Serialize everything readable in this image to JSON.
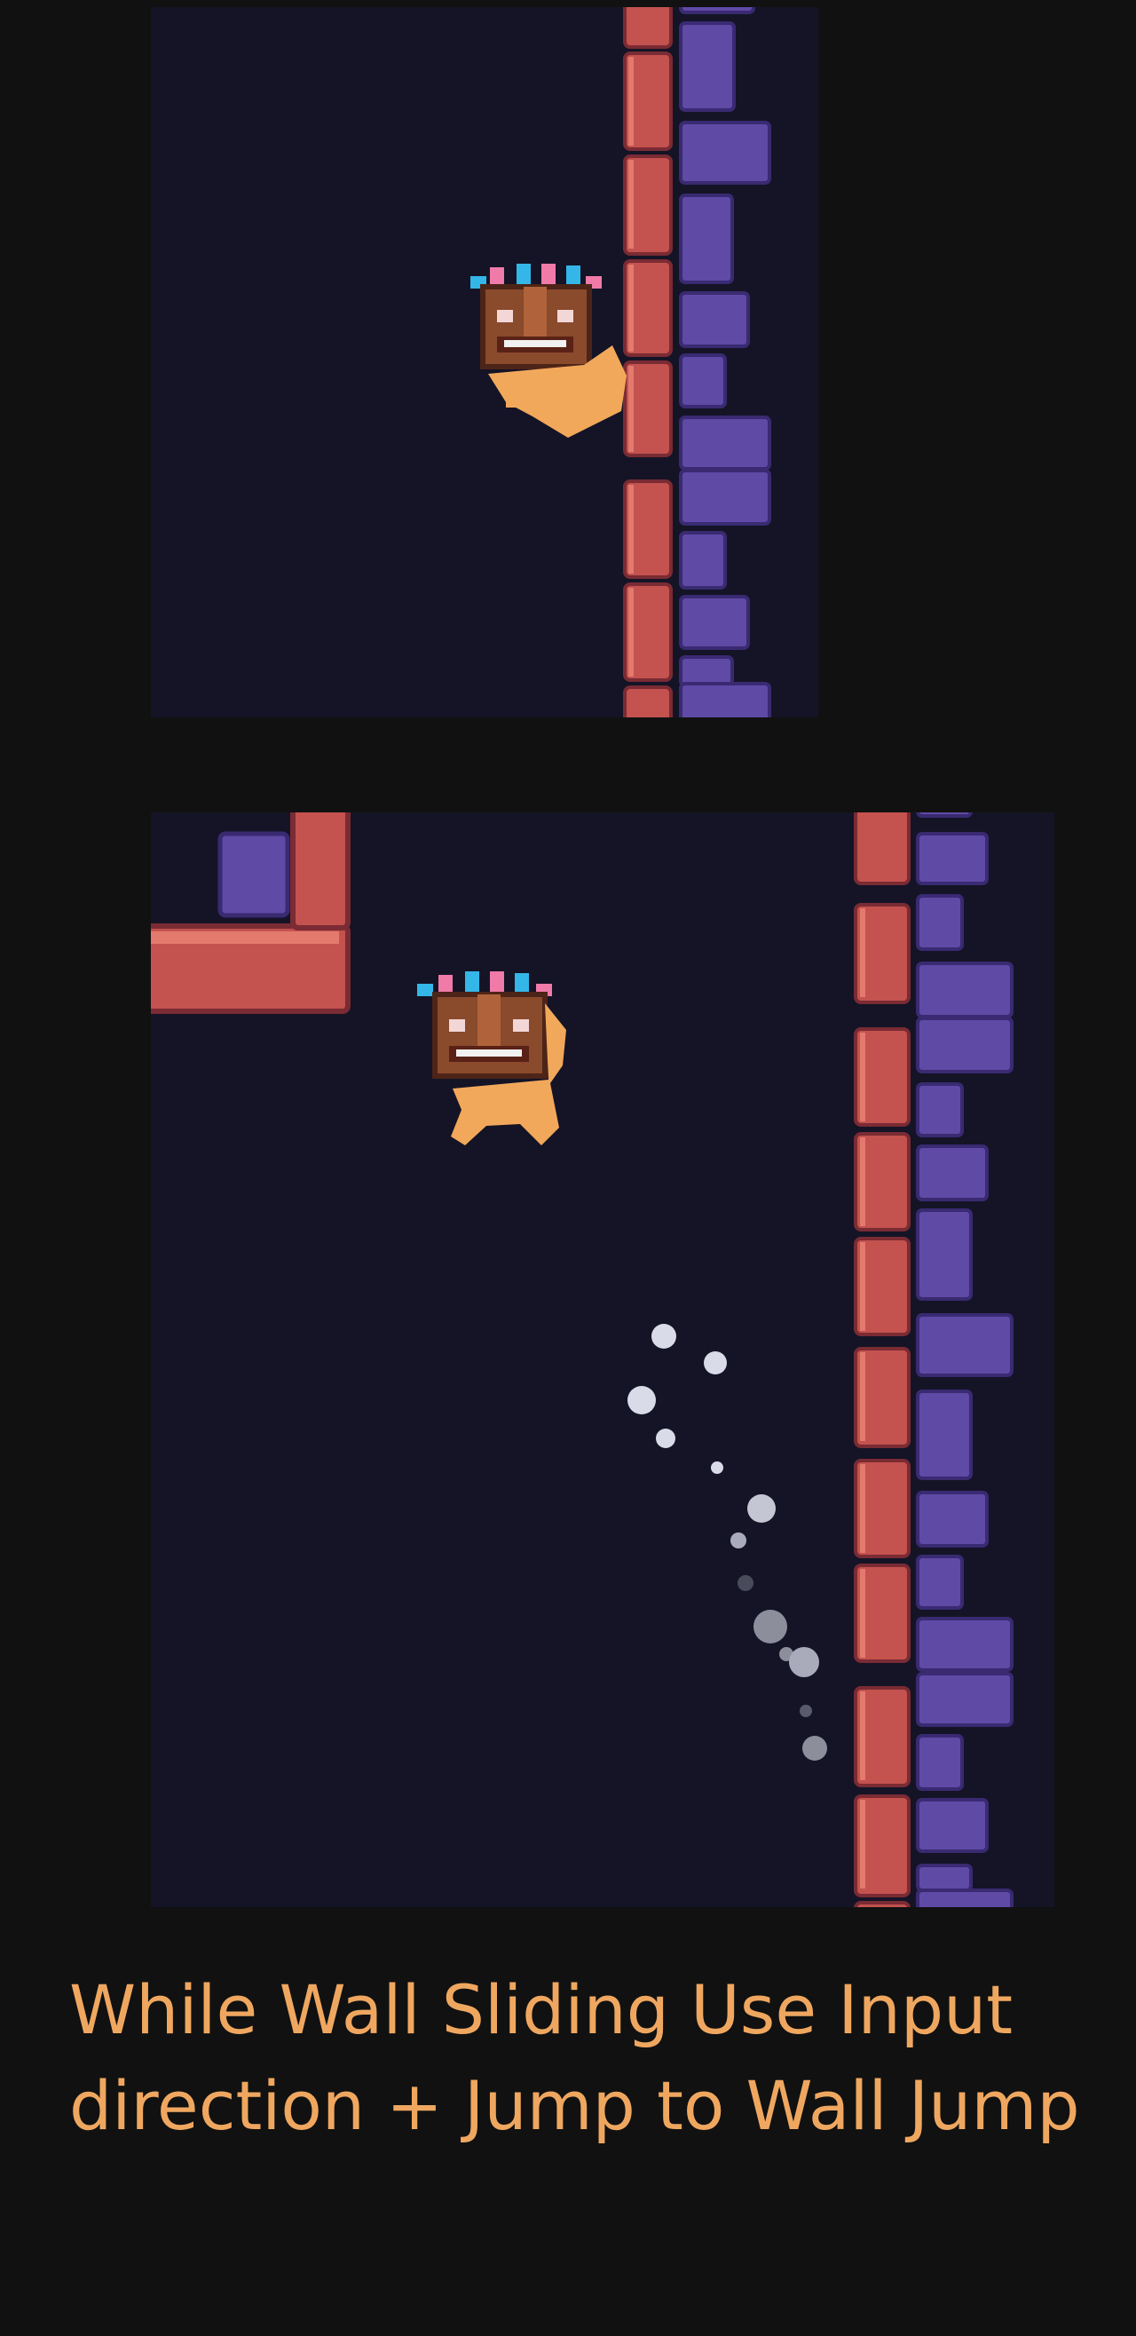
{
  "caption": {
    "line1": "While Wall Sliding Use Input",
    "line2": "direction + Jump to Wall Jump"
  },
  "colors": {
    "background": "#111111",
    "panel": "#141426",
    "brick_red": "#c4524f",
    "brick_red_highlight": "#e37a6d",
    "block_purple": "#5f4aa6",
    "block_purple_highlight": "#8b73d6",
    "caption": "#efa760",
    "dust": "#d9dbe8"
  },
  "scenes": [
    {
      "id": "wall-slide",
      "state": "sliding on wall"
    },
    {
      "id": "wall-jump",
      "state": "jumping off wall"
    }
  ]
}
